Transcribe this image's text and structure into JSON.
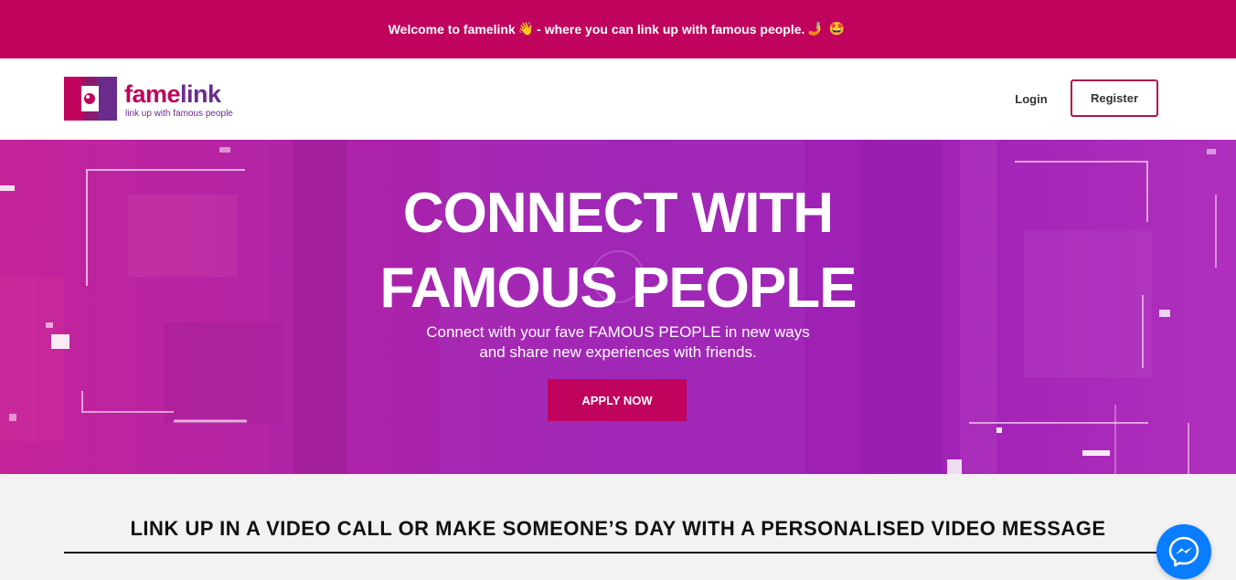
{
  "announcement": {
    "text_before": "Welcome to famelink",
    "emoji_wave": "👋",
    "text_after": "- where you can link up with famous people.",
    "emoji_hand": "🤳",
    "emoji_face": "🤩"
  },
  "header": {
    "logo_word_part1": "fame",
    "logo_word_part2": "link",
    "logo_tagline": "link up with famous people",
    "login_label": "Login",
    "register_label": "Register"
  },
  "hero": {
    "title": "CONNECT WITH FAMOUS PEOPLE",
    "subtitle_line1": "Connect with your fave FAMOUS PEOPLE in new ways",
    "subtitle_line2": "and share new experiences with friends.",
    "cta_label": "APPLY NOW"
  },
  "section": {
    "title": "LINK UP IN A VIDEO CALL OR MAKE SOMEONE’S DAY WITH A PERSONALISED VIDEO MESSAGE"
  },
  "widgets": {
    "messenger_icon": "messenger-icon"
  },
  "colors": {
    "brand_pink": "#c0035d",
    "brand_purple": "#6b2b8c",
    "messenger_blue": "#0a7cff"
  }
}
